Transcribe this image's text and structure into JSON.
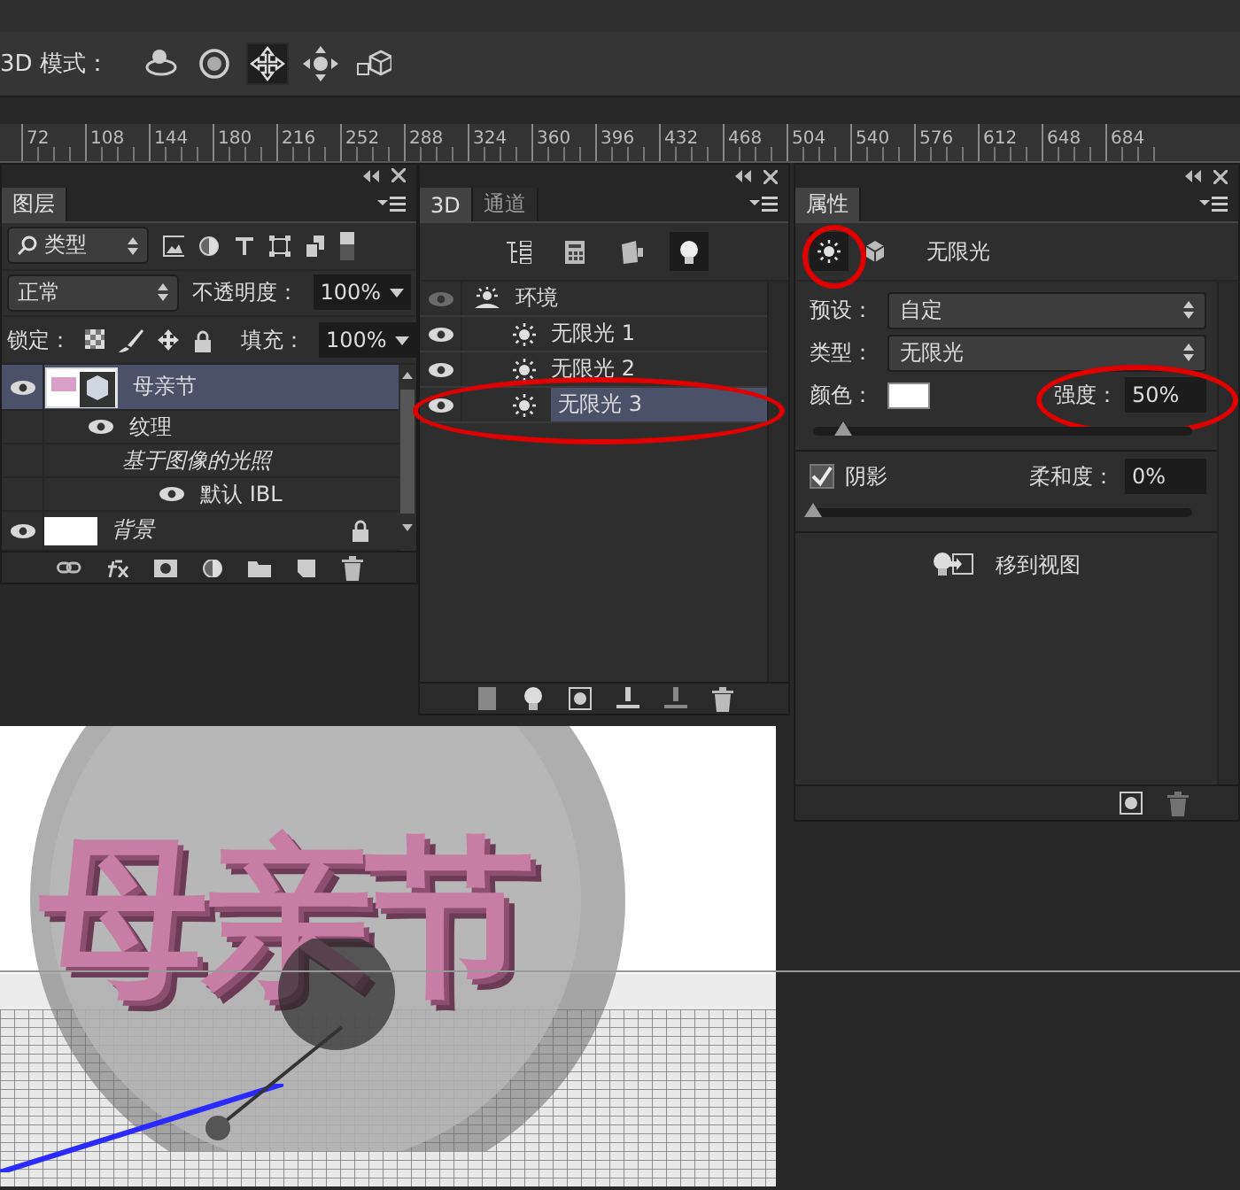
{
  "options_bar": {
    "label": "3D 模式：",
    "tools": [
      {
        "kind": "rotate",
        "selected": false
      },
      {
        "kind": "roll",
        "selected": false
      },
      {
        "kind": "drag",
        "selected": true
      },
      {
        "kind": "slide",
        "selected": false
      },
      {
        "kind": "scale",
        "selected": false
      }
    ]
  },
  "ruler": {
    "ticks": [
      "72",
      "108",
      "144",
      "180",
      "216",
      "252",
      "288",
      "324",
      "360",
      "396",
      "432",
      "468",
      "504",
      "540",
      "576",
      "612",
      "648",
      "684"
    ]
  },
  "layers_panel": {
    "tabs": [
      {
        "label": "图层",
        "selected": true
      }
    ],
    "filter": "类型",
    "blend_mode": "正常",
    "opacity_label": "不透明度：",
    "opacity": "100%",
    "lock_label": "锁定：",
    "fill_label": "填充：",
    "fill": "100%",
    "layers": [
      {
        "name": "母亲节",
        "kind": "mesh",
        "visible": true,
        "selected": true,
        "children": [
          {
            "name": "纹理",
            "kind": "group",
            "visible": true,
            "children": [
              {
                "name": "基于图像的光照",
                "kind": "label",
                "children": [
                  {
                    "name": "默认 IBL",
                    "kind": "item",
                    "visible": true
                  }
                ]
              }
            ]
          }
        ]
      },
      {
        "name": "背景",
        "kind": "background",
        "visible": true,
        "selected": false,
        "locked": true
      }
    ]
  },
  "scene_panel": {
    "tabs": [
      {
        "label": "3D",
        "selected": true
      },
      {
        "label": "通道",
        "selected": false
      }
    ],
    "filters": [
      {
        "kind": "scene",
        "selected": false
      },
      {
        "kind": "mesh",
        "selected": false
      },
      {
        "kind": "material",
        "selected": false
      },
      {
        "kind": "light",
        "selected": true
      }
    ],
    "items": [
      {
        "name": "环境",
        "kind": "environment",
        "visible": false,
        "selected": false,
        "highlighted": false,
        "children": [
          {
            "name": "无限光 1",
            "kind": "light",
            "visible": true,
            "selected": false,
            "highlighted": false
          },
          {
            "name": "无限光 2",
            "kind": "light",
            "visible": true,
            "selected": false,
            "highlighted": false
          },
          {
            "name": "无限光 3",
            "kind": "light",
            "visible": true,
            "selected": true,
            "highlighted": true
          }
        ]
      }
    ]
  },
  "properties_panel": {
    "tabs": [
      {
        "label": "属性",
        "selected": true
      }
    ],
    "modes": [
      {
        "kind": "light",
        "selected": true,
        "highlighted": true
      },
      {
        "kind": "coordinates",
        "selected": false,
        "highlighted": false
      }
    ],
    "title": "无限光",
    "preset_label": "预设：",
    "preset": "自定",
    "type_label": "类型：",
    "type": "无限光",
    "color_label": "颜色：",
    "color": "#ffffff",
    "intensity": {
      "label": "强度：",
      "value": "50%",
      "level": 0.08,
      "highlighted": true
    },
    "shadow": {
      "label": "阴影",
      "checked": true
    },
    "softness": {
      "label": "柔和度：",
      "value": "0%",
      "level": 0
    },
    "move_to_view": "移到视图"
  },
  "canvas": {
    "scene_text": "母亲节"
  }
}
